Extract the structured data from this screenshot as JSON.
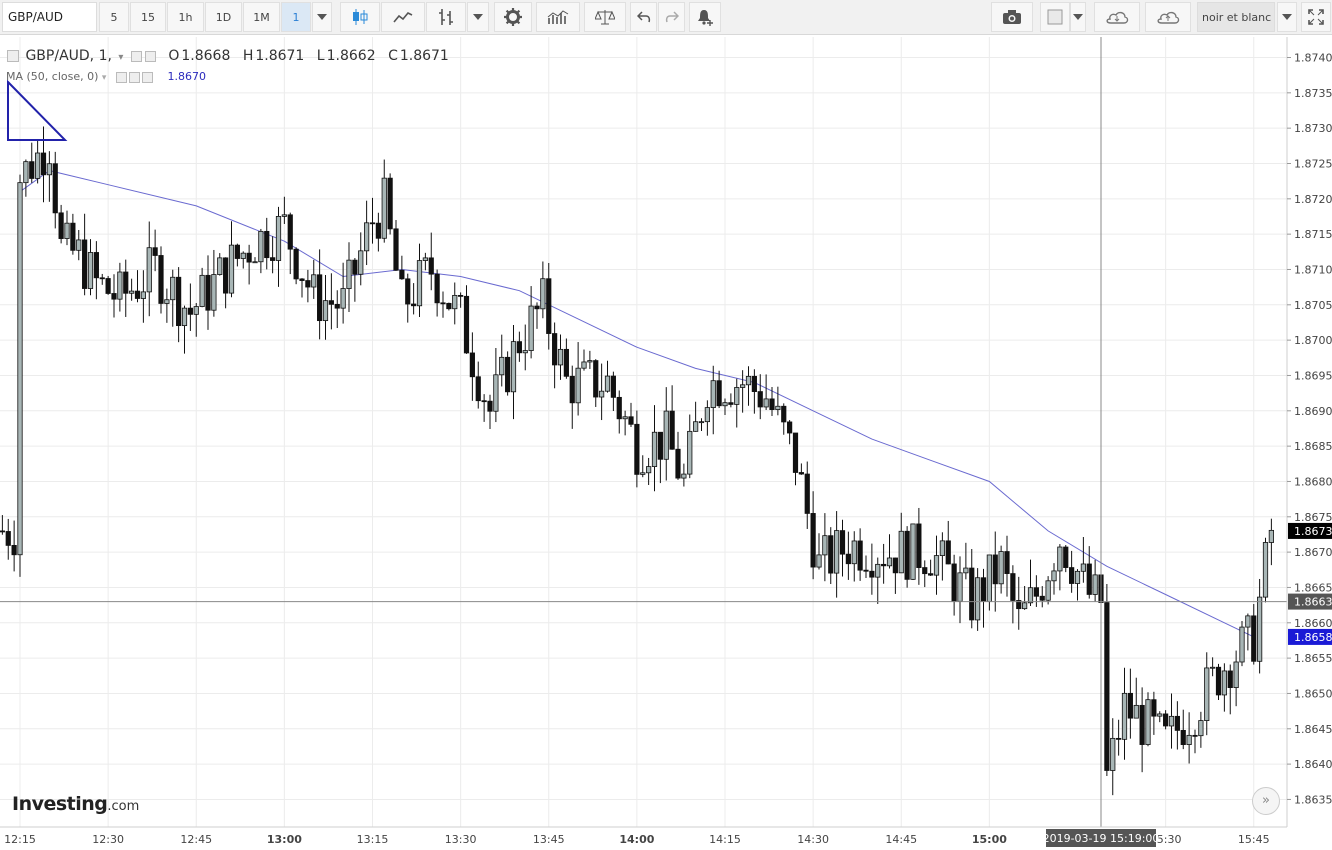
{
  "toolbar": {
    "symbol": "GBP/AUD",
    "intervals": [
      "5",
      "15",
      "1h",
      "1D",
      "1M",
      "1"
    ],
    "active_interval": "1",
    "theme": "noir et blanc"
  },
  "legend": {
    "symbol_line": "GBP/AUD, 1,",
    "o_label": "O",
    "o": "1.8668",
    "h_label": "H",
    "h": "1.8671",
    "l_label": "L",
    "l": "1.8662",
    "c_label": "C",
    "c": "1.8671",
    "ma_label": "MA (50, close, 0)",
    "ma_value": "1.8670"
  },
  "logo": {
    "main": "Investing",
    "suffix": ".com"
  },
  "colors": {
    "ma": "#6a6ad0",
    "up": "#a8b6b6",
    "down": "#111111",
    "grid": "#ececec",
    "current": "#000000",
    "ma_badge": "#1a1ad6"
  },
  "chart_data": {
    "type": "candlestick",
    "title": "",
    "x_ticks": [
      "12:15",
      "12:30",
      "12:45",
      "13:00",
      "13:15",
      "13:30",
      "13:45",
      "14:00",
      "14:15",
      "14:30",
      "14:45",
      "15:00",
      "15:30",
      "15:45"
    ],
    "x_ticks_bold": [
      "13:00",
      "14:00",
      "15:00"
    ],
    "y_ticks": [
      "1.8740",
      "1.8735",
      "1.8730",
      "1.8725",
      "1.8720",
      "1.8715",
      "1.8710",
      "1.8705",
      "1.8700",
      "1.8695",
      "1.8690",
      "1.8685",
      "1.8680",
      "1.8675",
      "1.8670",
      "1.8665",
      "1.8660",
      "1.8655",
      "1.8650",
      "1.8645",
      "1.8640",
      "1.8635"
    ],
    "ylim": [
      1.86311,
      1.87429
    ],
    "crosshair_time": "2019-03-19 15:19:00",
    "crosshair_price": "1.8663",
    "last_price": "1.8673",
    "ma_last": "1.8658",
    "grid": true,
    "moving_average": [
      {
        "t": "12:15",
        "v": 1.8721
      },
      {
        "t": "12:20",
        "v": 1.8724
      },
      {
        "t": "12:30",
        "v": 1.8722
      },
      {
        "t": "12:45",
        "v": 1.8719
      },
      {
        "t": "13:00",
        "v": 1.8714
      },
      {
        "t": "13:10",
        "v": 1.8709
      },
      {
        "t": "13:20",
        "v": 1.871
      },
      {
        "t": "13:30",
        "v": 1.8709
      },
      {
        "t": "13:40",
        "v": 1.8707
      },
      {
        "t": "13:50",
        "v": 1.8703
      },
      {
        "t": "14:00",
        "v": 1.8699
      },
      {
        "t": "14:10",
        "v": 1.8696
      },
      {
        "t": "14:20",
        "v": 1.8694
      },
      {
        "t": "14:30",
        "v": 1.869
      },
      {
        "t": "14:40",
        "v": 1.8686
      },
      {
        "t": "14:50",
        "v": 1.8683
      },
      {
        "t": "15:00",
        "v": 1.868
      },
      {
        "t": "15:10",
        "v": 1.8673
      },
      {
        "t": "15:20",
        "v": 1.8668
      },
      {
        "t": "15:30",
        "v": 1.8664
      },
      {
        "t": "15:40",
        "v": 1.866
      },
      {
        "t": "15:45",
        "v": 1.8658
      }
    ],
    "price_path": [
      {
        "t": "12:15",
        "v": 1.8723
      },
      {
        "t": "12:20",
        "v": 1.8728
      },
      {
        "t": "12:22",
        "v": 1.8713
      },
      {
        "t": "12:25",
        "v": 1.8712
      },
      {
        "t": "12:28",
        "v": 1.8708
      },
      {
        "t": "12:32",
        "v": 1.8706
      },
      {
        "t": "12:38",
        "v": 1.871
      },
      {
        "t": "12:44",
        "v": 1.8704
      },
      {
        "t": "12:50",
        "v": 1.871
      },
      {
        "t": "12:55",
        "v": 1.8714
      },
      {
        "t": "13:00",
        "v": 1.8716
      },
      {
        "t": "13:05",
        "v": 1.8706
      },
      {
        "t": "13:10",
        "v": 1.8705
      },
      {
        "t": "13:15",
        "v": 1.8717
      },
      {
        "t": "13:17",
        "v": 1.8719
      },
      {
        "t": "13:20",
        "v": 1.8705
      },
      {
        "t": "13:25",
        "v": 1.871
      },
      {
        "t": "13:30",
        "v": 1.8703
      },
      {
        "t": "13:35",
        "v": 1.869
      },
      {
        "t": "13:40",
        "v": 1.87
      },
      {
        "t": "13:44",
        "v": 1.8705
      },
      {
        "t": "13:48",
        "v": 1.8694
      },
      {
        "t": "13:55",
        "v": 1.8694
      },
      {
        "t": "14:00",
        "v": 1.8685
      },
      {
        "t": "14:05",
        "v": 1.8686
      },
      {
        "t": "14:08",
        "v": 1.868
      },
      {
        "t": "14:12",
        "v": 1.8694
      },
      {
        "t": "14:18",
        "v": 1.8694
      },
      {
        "t": "14:22",
        "v": 1.8692
      },
      {
        "t": "14:27",
        "v": 1.8683
      },
      {
        "t": "14:31",
        "v": 1.8668
      },
      {
        "t": "14:36",
        "v": 1.8671
      },
      {
        "t": "14:43",
        "v": 1.867
      },
      {
        "t": "14:50",
        "v": 1.867
      },
      {
        "t": "14:57",
        "v": 1.8663
      },
      {
        "t": "15:02",
        "v": 1.8668
      },
      {
        "t": "15:05",
        "v": 1.866
      },
      {
        "t": "15:08",
        "v": 1.8664
      },
      {
        "t": "15:12",
        "v": 1.8672
      },
      {
        "t": "15:17",
        "v": 1.8664
      },
      {
        "t": "15:19",
        "v": 1.8663
      },
      {
        "t": "15:20",
        "v": 1.8638
      },
      {
        "t": "15:23",
        "v": 1.8648
      },
      {
        "t": "15:26",
        "v": 1.8646
      },
      {
        "t": "15:30",
        "v": 1.8643
      },
      {
        "t": "15:35",
        "v": 1.8648
      },
      {
        "t": "15:40",
        "v": 1.8654
      },
      {
        "t": "15:45",
        "v": 1.8658
      },
      {
        "t": "15:48",
        "v": 1.8673
      }
    ]
  }
}
